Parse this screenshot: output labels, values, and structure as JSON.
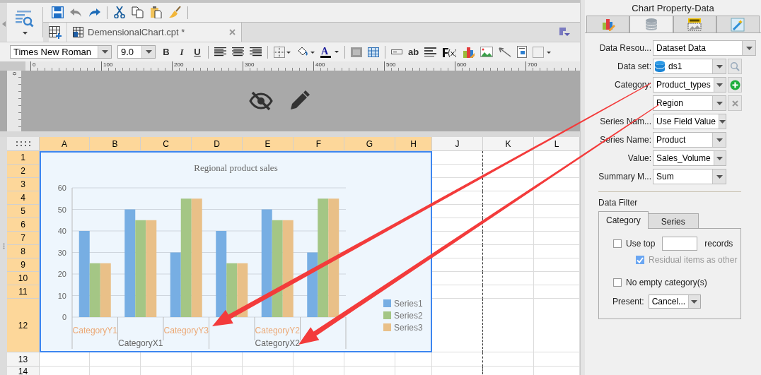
{
  "document_tab": {
    "title": "DemensionalChart.cpt *"
  },
  "format_toolbar": {
    "font": "Times New Roman",
    "size": "9.0",
    "bold": "B",
    "italic": "I",
    "underline": "U",
    "text_tool": "ab",
    "font_color": "A"
  },
  "ruler": {
    "labels": [
      "0",
      "100",
      "200",
      "300",
      "400",
      "500",
      "600",
      "700"
    ],
    "side_label": "0"
  },
  "sheet": {
    "columns": [
      {
        "label": "A",
        "selected": true
      },
      {
        "label": "B",
        "selected": true
      },
      {
        "label": "C",
        "selected": true
      },
      {
        "label": "D",
        "selected": true
      },
      {
        "label": "E",
        "selected": true
      },
      {
        "label": "F",
        "selected": true
      },
      {
        "label": "G",
        "selected": true
      },
      {
        "label": "H",
        "selected": true
      },
      {
        "label": "J",
        "selected": false
      },
      {
        "label": "K",
        "selected": false
      },
      {
        "label": "L",
        "selected": false
      }
    ],
    "rows": [
      {
        "label": "1",
        "selected": true
      },
      {
        "label": "2",
        "selected": true
      },
      {
        "label": "3",
        "selected": true
      },
      {
        "label": "4",
        "selected": true
      },
      {
        "label": "5",
        "selected": true
      },
      {
        "label": "6",
        "selected": true
      },
      {
        "label": "7",
        "selected": true
      },
      {
        "label": "8",
        "selected": true
      },
      {
        "label": "9",
        "selected": true
      },
      {
        "label": "10",
        "selected": true
      },
      {
        "label": "11",
        "selected": true
      },
      {
        "label": "12",
        "selected": true
      },
      {
        "label": "13",
        "selected": false
      },
      {
        "label": "14",
        "selected": false
      }
    ]
  },
  "chart": {
    "chart_data": {
      "type": "bar",
      "title": "Regional product sales",
      "categories": [
        "CategoryY1",
        null,
        "CategoryY3",
        null,
        "CategoryY2",
        null
      ],
      "grid": true,
      "legend": true,
      "ylim": [
        0,
        60
      ],
      "yticks": [
        0,
        10,
        20,
        30,
        40,
        50,
        60
      ],
      "series": [
        {
          "name": "Series1",
          "color": "#77aee3",
          "values": [
            40,
            50,
            30,
            40,
            50,
            30
          ]
        },
        {
          "name": "Series2",
          "color": "#a4c685",
          "values": [
            25,
            45,
            55,
            25,
            45,
            55
          ]
        },
        {
          "name": "Series3",
          "color": "#e9c088",
          "values": [
            25,
            45,
            55,
            25,
            45,
            55
          ]
        }
      ],
      "annotations": [
        {
          "text": "CategoryX1"
        },
        {
          "text": "CategoryX2"
        }
      ]
    }
  },
  "panel": {
    "title": "Chart Property-Data",
    "tabs": [
      {
        "selected": false
      },
      {
        "selected": true
      },
      {
        "selected": false
      },
      {
        "selected": false
      }
    ],
    "fields": [
      {
        "label": "Data Resou...",
        "value": "Dataset Data",
        "kind": "wide"
      },
      {
        "label": "Data set:",
        "value": "ds1",
        "kind": "dataset"
      },
      {
        "label": "Category:",
        "value": "Product_types",
        "kind": "add"
      },
      {
        "value": "Region",
        "kind": "remove"
      },
      {
        "label": "Series Nam...",
        "value": "Use Field Value",
        "kind": "select"
      },
      {
        "label": "Series Name:",
        "value": "Product",
        "kind": "select"
      },
      {
        "label": "Value:",
        "value": "Sales_Volume",
        "kind": "select"
      },
      {
        "label": "Summary M...",
        "value": "Sum",
        "kind": "select"
      }
    ]
  },
  "data_filter": {
    "title": "Data Filter",
    "tabs": [
      {
        "label": "Category",
        "selected": true
      },
      {
        "label": "Series",
        "selected": false
      }
    ],
    "use_top": {
      "label": "Use top",
      "checked": false,
      "suffix": "records"
    },
    "residual": {
      "label": "Residual items as other",
      "checked": true,
      "disabled": true
    },
    "no_empty": {
      "label": "No empty category(s)",
      "checked": false
    },
    "present": {
      "label": "Present:",
      "value": "Cancel..."
    }
  }
}
